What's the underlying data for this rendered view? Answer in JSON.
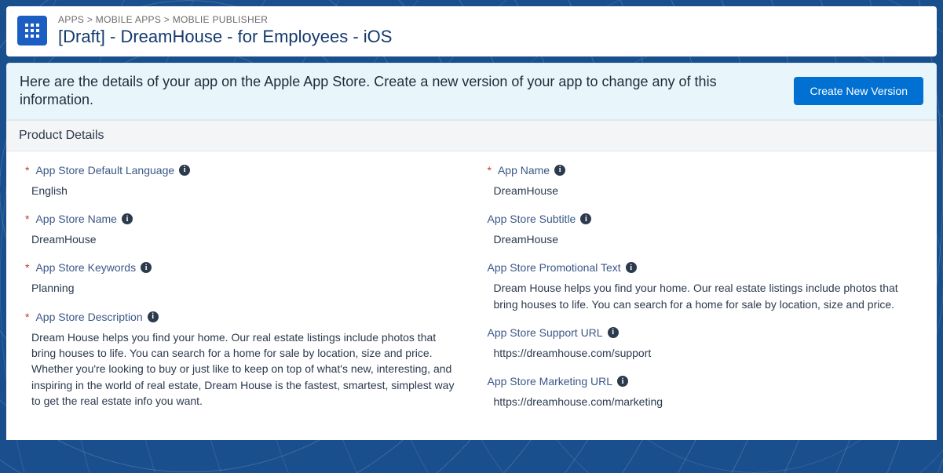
{
  "breadcrumb": {
    "items": [
      "APPS",
      "MOBILE APPS",
      "MOBLIE PUBLISHER"
    ]
  },
  "page_title": "[Draft] - DreamHouse - for Employees - iOS",
  "banner": {
    "text": "Here are the details of your app on the Apple App Store. Create a new version of your app to change any of this information.",
    "button_label": "Create New Version"
  },
  "section_title": "Product Details",
  "fields_left": [
    {
      "label": "App Store Default Language",
      "required": true,
      "value": "English"
    },
    {
      "label": "App Store Name",
      "required": true,
      "value": "DreamHouse"
    },
    {
      "label": "App Store Keywords",
      "required": true,
      "value": "Planning"
    },
    {
      "label": "App Store Description",
      "required": true,
      "value": "Dream House helps you find your home. Our real estate listings include photos that bring houses to life. You can search for a home for sale by location, size and price. Whether you're looking to buy or just like to keep on top of what's new, interesting, and inspiring in the world of real estate, Dream House is the fastest, smartest, simplest way to get the real estate info you want."
    }
  ],
  "fields_right": [
    {
      "label": "App Name",
      "required": true,
      "value": "DreamHouse"
    },
    {
      "label": "App Store Subtitle",
      "required": false,
      "value": "DreamHouse"
    },
    {
      "label": "App Store Promotional Text",
      "required": false,
      "value": "Dream House helps you find your home. Our real estate listings include photos that bring houses to life. You can search for a home for sale by location, size and price."
    },
    {
      "label": "App Store Support URL",
      "required": false,
      "value": "https://dreamhouse.com/support"
    },
    {
      "label": "App Store Marketing URL",
      "required": false,
      "value": "https://dreamhouse.com/marketing"
    }
  ]
}
